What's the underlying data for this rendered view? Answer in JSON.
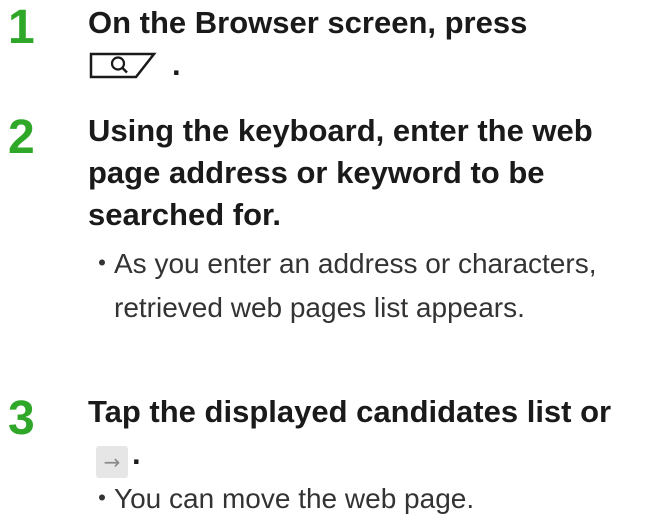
{
  "steps": [
    {
      "number": "1",
      "text_before_icon": "On the Browser screen, press",
      "text_after_icon": ".",
      "icon": "search-key-icon"
    },
    {
      "number": "2",
      "text": "Using the keyboard, enter the web page address or keyword to be searched for.",
      "note": "As you enter an address or characters, retrieved web pages list appears."
    },
    {
      "number": "3",
      "text_before_icon": "Tap the displayed candidates list or",
      "text_after_icon": ".",
      "icon": "arrow-right-icon",
      "icon_glyph": "→",
      "note": "You can move the web page."
    }
  ],
  "bullet": "・",
  "colors": {
    "step_number": "#2fa829",
    "text": "#1a1a1a",
    "key_background": "#e6e6e6"
  }
}
